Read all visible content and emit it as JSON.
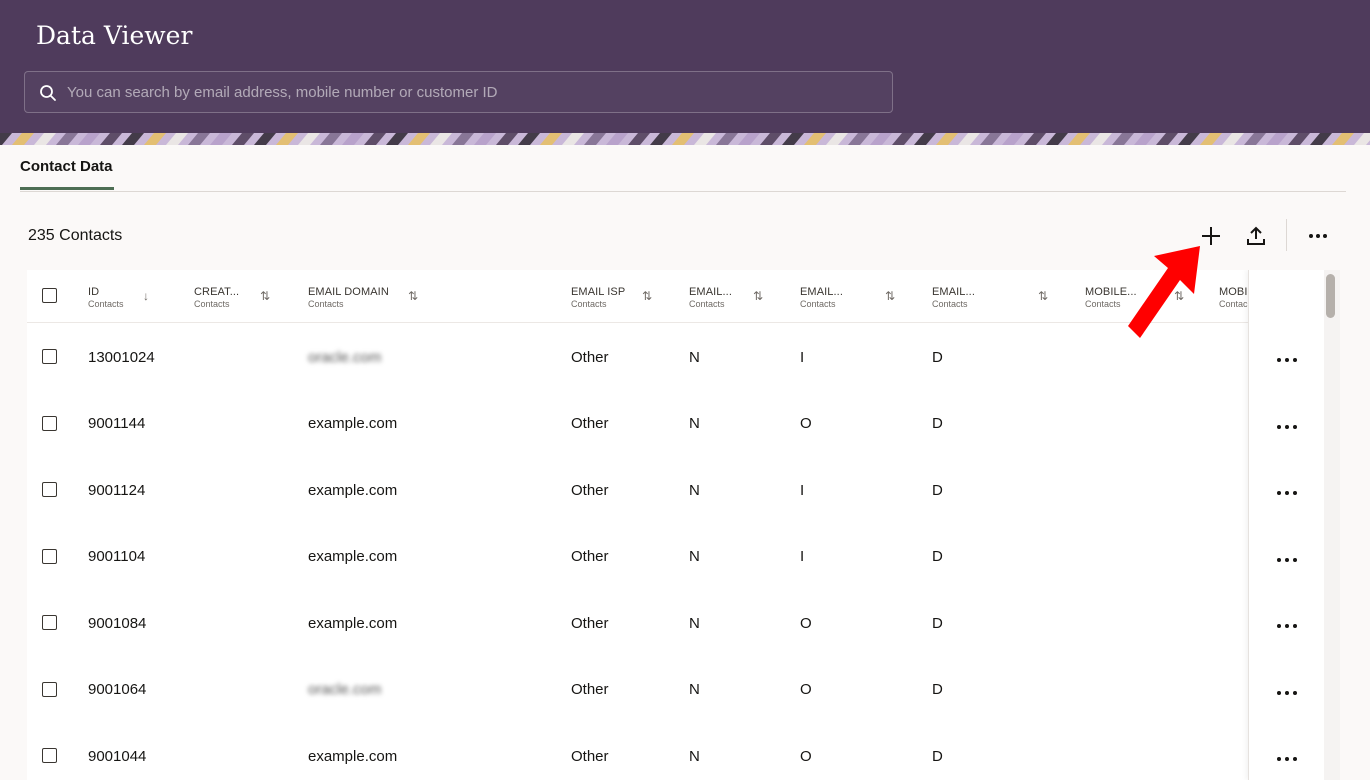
{
  "app": {
    "title": "Data Viewer"
  },
  "search": {
    "placeholder": "You can search by email address, mobile number or customer ID",
    "icon": "search-icon"
  },
  "tabs": [
    {
      "label": "Contact Data",
      "active": true
    }
  ],
  "summary": {
    "count_label": "235 Contacts"
  },
  "toolbar": {
    "add_icon": "plus-icon",
    "export_icon": "upload-icon",
    "more_icon": "more-horizontal-icon"
  },
  "table": {
    "columns": [
      {
        "title": "ID",
        "sub": "Contacts",
        "sort": "↓"
      },
      {
        "title": "CREAT...",
        "sub": "Contacts",
        "sort": "⇅"
      },
      {
        "title": "EMAIL DOMAIN",
        "sub": "Contacts",
        "sort": "⇅"
      },
      {
        "title": "EMAIL ISP",
        "sub": "Contacts",
        "sort": "⇅"
      },
      {
        "title": "EMAIL...",
        "sub": "Contacts",
        "sort": "⇅"
      },
      {
        "title": "EMAIL...",
        "sub": "Contacts",
        "sort": "⇅"
      },
      {
        "title": "EMAIL...",
        "sub": "Contacts",
        "sort": "⇅"
      },
      {
        "title": "MOBILE...",
        "sub": "Contacts",
        "sort": "⇅"
      },
      {
        "title": "MOBI",
        "sub": "Contac",
        "sort": ""
      }
    ],
    "rows": [
      {
        "id": "13001024",
        "created": "",
        "domain": "oracle.com",
        "domain_blurred": true,
        "isp": "Other",
        "c5": "N",
        "c6": "I",
        "c7": "D"
      },
      {
        "id": "9001144",
        "created": "",
        "domain": "example.com",
        "domain_blurred": false,
        "isp": "Other",
        "c5": "N",
        "c6": "O",
        "c7": "D"
      },
      {
        "id": "9001124",
        "created": "",
        "domain": "example.com",
        "domain_blurred": false,
        "isp": "Other",
        "c5": "N",
        "c6": "I",
        "c7": "D"
      },
      {
        "id": "9001104",
        "created": "",
        "domain": "example.com",
        "domain_blurred": false,
        "isp": "Other",
        "c5": "N",
        "c6": "I",
        "c7": "D"
      },
      {
        "id": "9001084",
        "created": "",
        "domain": "example.com",
        "domain_blurred": false,
        "isp": "Other",
        "c5": "N",
        "c6": "O",
        "c7": "D"
      },
      {
        "id": "9001064",
        "created": "",
        "domain": "oracle.com",
        "domain_blurred": true,
        "isp": "Other",
        "c5": "N",
        "c6": "O",
        "c7": "D"
      },
      {
        "id": "9001044",
        "created": "",
        "domain": "example.com",
        "domain_blurred": false,
        "isp": "Other",
        "c5": "N",
        "c6": "O",
        "c7": "D"
      }
    ],
    "row_action_icon": "more-horizontal-icon"
  },
  "colors": {
    "header_bg": "#4f3b5c",
    "tab_underline": "#4d6e54",
    "annotation_arrow": "#ff0000"
  }
}
